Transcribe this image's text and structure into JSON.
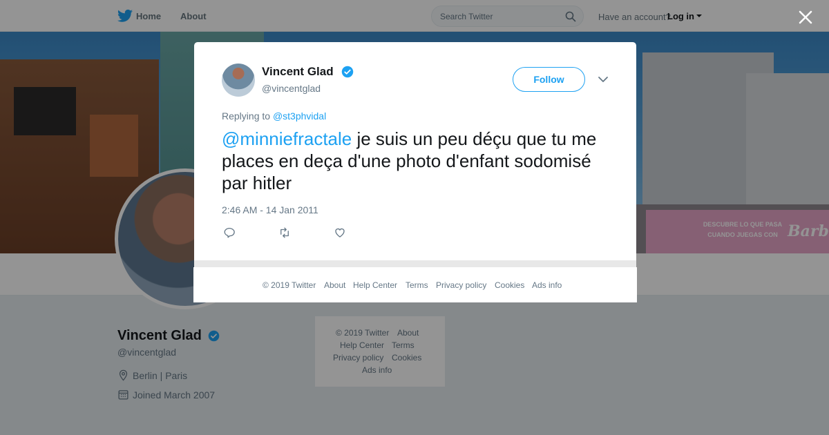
{
  "nav": {
    "home_label": "Home",
    "about_label": "About",
    "search_placeholder": "Search Twitter",
    "account_prompt": "Have an account?",
    "login_label": "Log in"
  },
  "banner": {
    "ad_text": "DESCUBRE LO QUE PASA CUANDO JUEGAS CON",
    "ad_brand": "Barbie"
  },
  "profile": {
    "name": "Vincent Glad",
    "handle": "@vincentglad",
    "location": "Berlin | Paris",
    "joined": "Joined March 2007"
  },
  "sidebar_footer": {
    "copyright": "© 2019 Twitter",
    "about": "About",
    "help": "Help Center",
    "terms": "Terms",
    "privacy": "Privacy policy",
    "cookies": "Cookies",
    "ads": "Ads info"
  },
  "tweet": {
    "author_name": "Vincent Glad",
    "author_handle": "@vincentglad",
    "follow_label": "Follow",
    "replying_prefix": "Replying to",
    "replying_to": "@st3phvidal",
    "mention": "@minniefractale",
    "text": " je suis un peu déçu que tu me places en deça d'une photo d'enfant sodomisé par hitler",
    "timestamp": "2:46 AM - 14 Jan 2011"
  },
  "modal_footer": {
    "copyright": "© 2019 Twitter",
    "about": "About",
    "help": "Help Center",
    "terms": "Terms",
    "privacy": "Privacy policy",
    "cookies": "Cookies",
    "ads": "Ads info"
  },
  "colors": {
    "twitter_blue": "#1da1f2",
    "text_primary": "#14171a",
    "text_secondary": "#657786"
  },
  "icons": [
    "twitter-bird-icon",
    "search-icon",
    "close-icon",
    "verified-icon",
    "chevron-down-icon",
    "reply-icon",
    "retweet-icon",
    "heart-icon",
    "location-icon",
    "calendar-icon"
  ]
}
